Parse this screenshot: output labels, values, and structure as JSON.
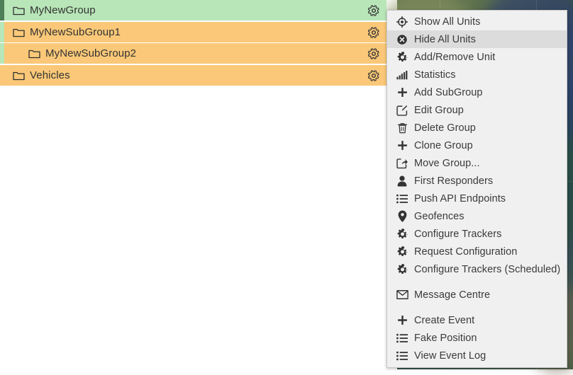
{
  "group_tree": {
    "rows": [
      {
        "label": "MyNewGroup",
        "level": 0,
        "bg_color": "#b8e6b8",
        "accent_color": "#4f7f58",
        "icon": "folder-icon",
        "gear_icon": "gear-icon"
      },
      {
        "label": "MyNewSubGroup1",
        "level": 1,
        "bg_color": "#fac878",
        "accent_color": "#b8e6b8",
        "icon": "folder-icon",
        "gear_icon": "gear-icon"
      },
      {
        "label": "MyNewSubGroup2",
        "level": 2,
        "bg_color": "#fac878",
        "accent_color": "#b8e6b8",
        "icon": "folder-icon",
        "gear_icon": "gear-icon"
      },
      {
        "label": "Vehicles",
        "level": 0,
        "bg_color": "#fac878",
        "accent_color": "#fac878",
        "icon": "folder-icon",
        "gear_icon": "gear-icon"
      }
    ]
  },
  "context_menu": {
    "items": [
      {
        "label": "Show All Units",
        "icon": "crosshair-icon",
        "highlighted": false,
        "separator_before": false
      },
      {
        "label": "Hide All Units",
        "icon": "close-circle-icon",
        "highlighted": true,
        "separator_before": false
      },
      {
        "label": "Add/Remove Unit",
        "icon": "gear-icon",
        "highlighted": false,
        "separator_before": false
      },
      {
        "label": "Statistics",
        "icon": "bar-chart-icon",
        "highlighted": false,
        "separator_before": false
      },
      {
        "label": "Add SubGroup",
        "icon": "plus-icon",
        "highlighted": false,
        "separator_before": false
      },
      {
        "label": "Edit Group",
        "icon": "edit-pencil-icon",
        "highlighted": false,
        "separator_before": false
      },
      {
        "label": "Delete Group",
        "icon": "trash-icon",
        "highlighted": false,
        "separator_before": false
      },
      {
        "label": "Clone Group",
        "icon": "plus-icon",
        "highlighted": false,
        "separator_before": false
      },
      {
        "label": "Move Group...",
        "icon": "share-arrow-icon",
        "highlighted": false,
        "separator_before": false
      },
      {
        "label": "First Responders",
        "icon": "person-icon",
        "highlighted": false,
        "separator_before": false
      },
      {
        "label": "Push API Endpoints",
        "icon": "list-icon",
        "highlighted": false,
        "separator_before": false
      },
      {
        "label": "Geofences",
        "icon": "map-pin-icon",
        "highlighted": false,
        "separator_before": false
      },
      {
        "label": "Configure Trackers",
        "icon": "gear-icon",
        "highlighted": false,
        "separator_before": false
      },
      {
        "label": "Request Configuration",
        "icon": "gear-icon",
        "highlighted": false,
        "separator_before": false
      },
      {
        "label": "Configure Trackers (Scheduled)",
        "icon": "gear-icon",
        "highlighted": false,
        "separator_before": false
      },
      {
        "label": "Message Centre",
        "icon": "envelope-icon",
        "highlighted": false,
        "separator_before": true
      },
      {
        "label": "Create Event",
        "icon": "plus-icon",
        "highlighted": false,
        "separator_before": true
      },
      {
        "label": "Fake Position",
        "icon": "list-icon",
        "highlighted": false,
        "separator_before": false
      },
      {
        "label": "View Event Log",
        "icon": "list-icon",
        "highlighted": false,
        "separator_before": false
      }
    ]
  },
  "map": {
    "name": "satellite-map-background"
  },
  "colors": {
    "group_selected_green": "#b8e6b8",
    "group_orange": "#fac878",
    "accent_dark_green": "#4f7f58",
    "menu_background": "#f0f0f0",
    "menu_highlight": "#dcdcdc",
    "text": "#3a3a3a"
  }
}
